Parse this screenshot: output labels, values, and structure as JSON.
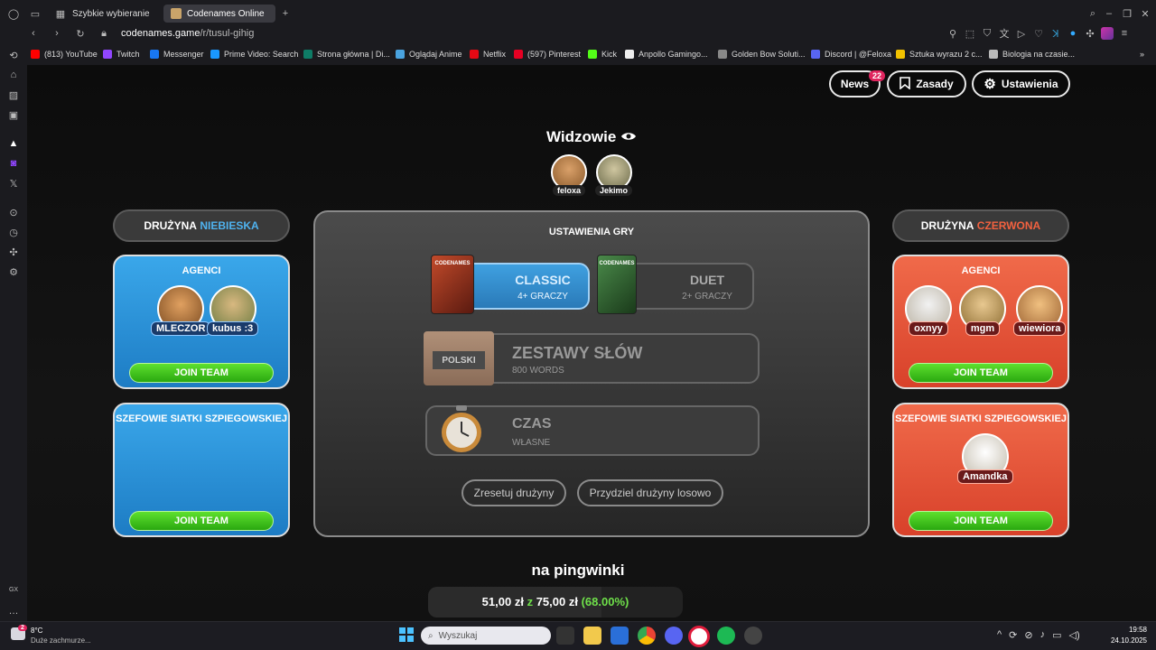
{
  "browser": {
    "tabs": [
      {
        "label": "Szybkie wybieranie"
      },
      {
        "label": "Codenames Online"
      }
    ],
    "new_tab_icon": "plus-icon",
    "url": {
      "host": "codenames.game",
      "path": "/r/tusul-gihig"
    },
    "bookmarks": [
      {
        "label": "(813) YouTube",
        "color": "#ff0000"
      },
      {
        "label": "Twitch",
        "color": "#9146ff"
      },
      {
        "label": "Messenger",
        "color": "#1877f2"
      },
      {
        "label": "Prime Video: Search",
        "color": "#1a98ff"
      },
      {
        "label": "Strona główna | Di...",
        "color": "#0e7c66"
      },
      {
        "label": "Oglądaj Anime",
        "color": "#4aa3df"
      },
      {
        "label": "Netflix",
        "color": "#e50914"
      },
      {
        "label": "(597) Pinterest",
        "color": "#e60023"
      },
      {
        "label": "Kick",
        "color": "#53fc18"
      },
      {
        "label": "Anpollo Gamingo...",
        "color": "#eeeeee"
      },
      {
        "label": "Golden Bow Soluti...",
        "color": "#888888"
      },
      {
        "label": "Discord | @Feloxa",
        "color": "#5865f2"
      },
      {
        "label": "Sztuka wyrazu 2 c...",
        "color": "#f2c200"
      },
      {
        "label": "Biologia na czasie...",
        "color": "#bbbbbb"
      }
    ],
    "sidebar_label": "GX"
  },
  "header_buttons": {
    "news": "News",
    "news_badge": "22",
    "rules": "Zasady",
    "settings": "Ustawienia"
  },
  "spectators": {
    "title": "Widzowie",
    "players": [
      "feloxa",
      "Jekimo"
    ]
  },
  "blue_team": {
    "header_prefix": "DRUŻYNA",
    "header_color_word": "NIEBIESKA",
    "accent": "#4fb3f0",
    "agents_title": "AGENCI",
    "agents": [
      "MLECZOR",
      "kubus :3"
    ],
    "spymasters_title": "SZEFOWIE SIATKI SZPIEGOWSKIEJ",
    "spymasters": [],
    "join_label": "JOIN TEAM"
  },
  "red_team": {
    "header_prefix": "DRUŻYNA",
    "header_color_word": "CZERWONA",
    "accent": "#f2613f",
    "agents_title": "AGENCI",
    "agents": [
      "oxnyy",
      "mgm",
      "wiewiora"
    ],
    "spymasters_title": "SZEFOWIE SIATKI SZPIEGOWSKIEJ",
    "spymasters": [
      "Amandka"
    ],
    "join_label": "JOIN TEAM"
  },
  "game_settings": {
    "title": "USTAWIENIA GRY",
    "box_brand": "CODENAMES",
    "classic": {
      "label": "CLASSIC",
      "sub": "4+ GRACZY"
    },
    "duet": {
      "label": "DUET",
      "sub": "2+ GRACZY"
    },
    "word_sets": {
      "label": "ZESTAWY SŁÓW",
      "sub": "800 WORDS",
      "box_label": "POLSKI"
    },
    "timer": {
      "label": "CZAS",
      "sub": "WŁASNE"
    },
    "reset_button": "Zresetuj drużyny",
    "random_button": "Przydziel drużyny losowo"
  },
  "donation": {
    "title": "na pingwinki",
    "current": "51,00 zł",
    "of": "z",
    "goal": "75,00 zł",
    "percent_text": "(68.00%)",
    "progress": 0.68
  },
  "taskbar": {
    "weather_temp": "8°C",
    "weather_desc": "Duże zachmurze...",
    "weather_badge": "2",
    "search_placeholder": "Wyszukaj",
    "time": "19:58",
    "date": "24.10.2025"
  }
}
